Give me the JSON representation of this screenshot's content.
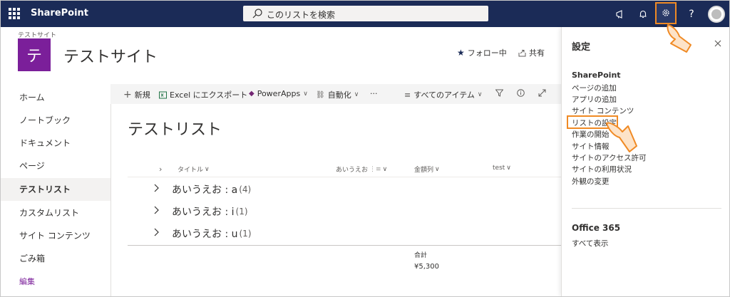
{
  "topbar": {
    "brand": "SharePoint",
    "search_placeholder": "このリストを検索",
    "help_label": "?"
  },
  "site": {
    "breadcrumb": "テストサイト",
    "logo_letter": "テ",
    "title": "テストサイト",
    "follow_label": "フォロー中",
    "share_label": "共有"
  },
  "nav": {
    "items": [
      "ホーム",
      "ノートブック",
      "ドキュメント",
      "ページ",
      "テストリスト",
      "カスタムリスト",
      "サイト コンテンツ",
      "ごみ箱"
    ],
    "edit_label": "編集"
  },
  "commands": {
    "new": "新規",
    "export": "Excel にエクスポート",
    "powerapps": "PowerApps",
    "automate": "自動化",
    "more": "···",
    "view": "すべてのアイテム"
  },
  "list": {
    "title": "テストリスト",
    "columns": [
      "タイトル",
      "あいうえお",
      "金額列",
      "test"
    ],
    "groups": [
      {
        "label": "あいうえお : a",
        "count": "(4)"
      },
      {
        "label": "あいうえお : i",
        "count": "(1)"
      },
      {
        "label": "あいうえお : u",
        "count": "(1)"
      }
    ],
    "total_label": "合計",
    "total_value": "¥5,300"
  },
  "panel": {
    "title": "設定",
    "section1": "SharePoint",
    "links": [
      "ページの追加",
      "アプリの追加",
      "サイト コンテンツ",
      "リストの設定",
      "作業の開始",
      "サイト情報",
      "サイトのアクセス許可",
      "サイトの利用状況",
      "外観の変更"
    ],
    "section2": "Office 365",
    "show_all": "すべて表示"
  },
  "colors": {
    "suite_bar": "#1b2b57",
    "site_logo": "#7b1f9a",
    "highlight": "#f08a24",
    "link_accent": "#7b1f9a"
  },
  "icons": [
    "waffle-icon",
    "search-icon",
    "megaphone-icon",
    "bell-icon",
    "gear-icon",
    "star-icon",
    "share-icon",
    "plus-icon",
    "excel-icon",
    "powerapps-icon",
    "flow-icon",
    "view-icon",
    "filter-icon",
    "info-icon",
    "expand-icon",
    "chevron-right-icon",
    "close-icon",
    "pointer-cursor-icon"
  ]
}
